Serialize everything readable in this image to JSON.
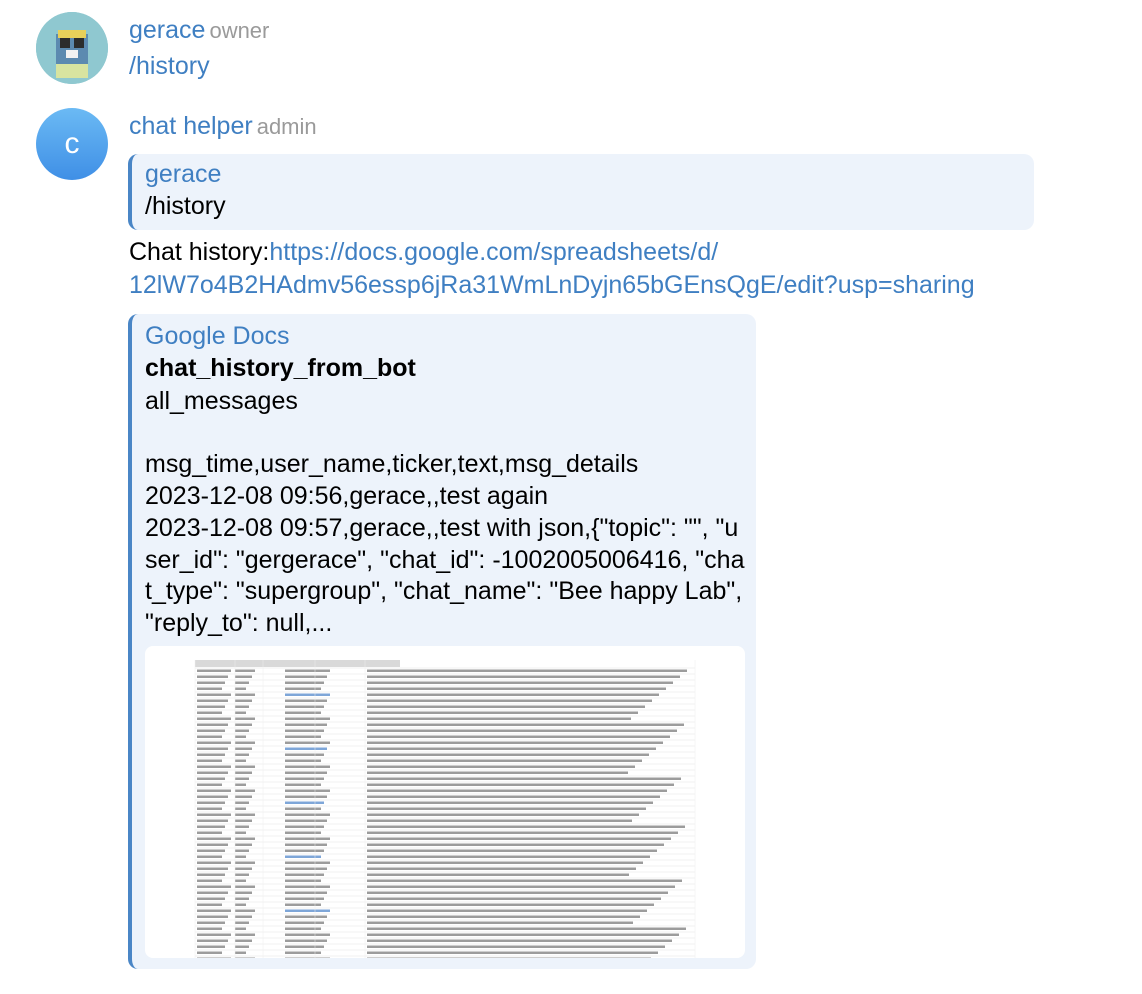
{
  "messages": [
    {
      "author": "gerace",
      "role": "owner",
      "text": "/history"
    },
    {
      "author": "chat helper",
      "role": "admin",
      "avatar_letter": "c",
      "reply": {
        "author": "gerace",
        "text": "/history"
      },
      "text_prefix": "Chat history:",
      "link_line1": "https://docs.google.com/spreadsheets/d/",
      "link_line2": "12lW7o4B2HAdmv56essp6jRa31WmLnDyjn65bGEnsQgE/edit?usp=sharing",
      "preview": {
        "site": "Google Docs",
        "title": "chat_history_from_bot",
        "description": "all_messages\n\nmsg_time,user_name,ticker,text,msg_details\n2023-12-08 09:56,gerace,,test again\n2023-12-08 09:57,gerace,,test with json,{\"topic\": \"\", \"user_id\": \"gergerace\", \"chat_id\": -1002005006416, \"chat_type\": \"supergroup\", \"chat_name\": \"Bee happy Lab\", \"reply_to\": null,...",
        "image_icon": "spreadsheet-thumbnail"
      }
    }
  ],
  "colors": {
    "link": "#3f7fc2",
    "role": "#9a9a9a",
    "bubble": "#edf3fb",
    "accent_bar": "#4a86c6"
  }
}
